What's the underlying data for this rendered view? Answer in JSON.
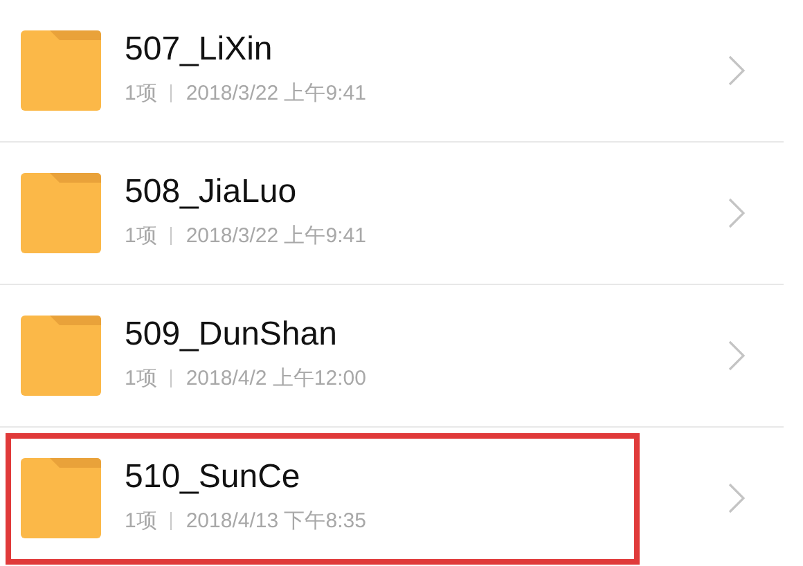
{
  "folders": [
    {
      "name": "507_LiXin",
      "count": "1项",
      "modified": "2018/3/22 上午9:41",
      "highlighted": false
    },
    {
      "name": "508_JiaLuo",
      "count": "1项",
      "modified": "2018/3/22 上午9:41",
      "highlighted": false
    },
    {
      "name": "509_DunShan",
      "count": "1项",
      "modified": "2018/4/2 上午12:00",
      "highlighted": false
    },
    {
      "name": "510_SunCe",
      "count": "1项",
      "modified": "2018/4/13 下午8:35",
      "highlighted": true
    }
  ]
}
